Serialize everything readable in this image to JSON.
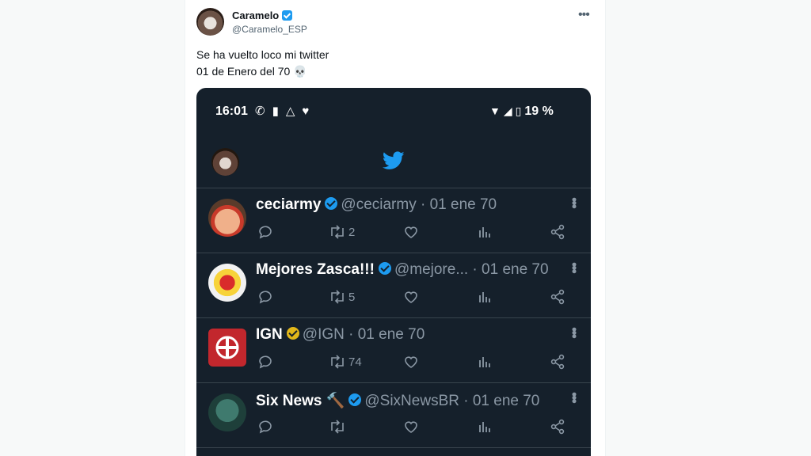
{
  "post": {
    "author_name": "Caramelo",
    "author_handle": "@Caramelo_ESP",
    "text_line1": "Se ha vuelto loco mi twitter",
    "text_line2": "01 de Enero del 70 💀"
  },
  "screenshot": {
    "status": {
      "time": "16:01",
      "battery": "19 %"
    },
    "tweets": [
      {
        "name": "ceciarmy",
        "meta": "@ceciarmy · 01 ene 70",
        "badge": "blue",
        "retweets": "2"
      },
      {
        "name": "Mejores Zasca!!!",
        "meta": "@mejore... · 01 ene 70",
        "badge": "blue",
        "retweets": "5"
      },
      {
        "name": "IGN",
        "meta": "@IGN · 01 ene 70",
        "badge": "gold",
        "retweets": "74"
      },
      {
        "name": "Six News 🔨",
        "meta": "@SixNewsBR · 01 ene 70",
        "badge": "blue",
        "retweets": ""
      }
    ]
  },
  "colors": {
    "dark_bg": "#15202b",
    "twitter_blue": "#1d9bf0",
    "muted": "#8b98a5"
  }
}
